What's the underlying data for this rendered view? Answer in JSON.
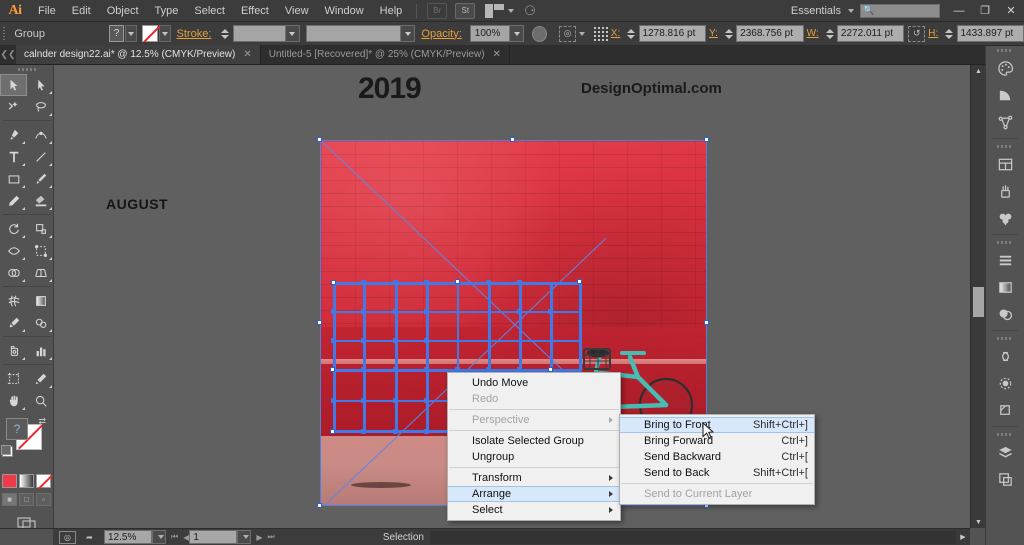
{
  "app": {
    "name": "Adobe Illustrator",
    "logo": "Ai"
  },
  "menubar": {
    "items": [
      "File",
      "Edit",
      "Object",
      "Type",
      "Select",
      "Effect",
      "View",
      "Window",
      "Help"
    ],
    "bridge_label": "Br",
    "stock_label": "St",
    "workspace": "Essentials",
    "search_placeholder": "",
    "window_buttons": {
      "minimize": "—",
      "restore": "❐",
      "close": "✕"
    }
  },
  "controlbar": {
    "selection_type": "Group",
    "fill_label": "?",
    "stroke_label": "Stroke:",
    "stroke_weight": "",
    "stroke_profile": "",
    "opacity_label": "Opacity:",
    "opacity_value": "100%",
    "x_label": "X:",
    "x_value": "1278.816 pt",
    "y_label": "Y:",
    "y_value": "2368.756 pt",
    "w_label": "W:",
    "w_value": "2272.011 pt",
    "h_label": "H:",
    "h_value": "1433.897 pt"
  },
  "tabs": [
    {
      "title": "calnder design22.ai* @ 12.5% (CMYK/Preview)",
      "active": true,
      "close": "✕"
    },
    {
      "title": "Untitled-5 [Recovered]* @ 25% (CMYK/Preview)",
      "active": false,
      "close": "✕"
    }
  ],
  "toolbar": {
    "tools": [
      {
        "name": "selection-tool",
        "selected": true
      },
      {
        "name": "direct-selection-tool",
        "selected": false
      },
      {
        "name": "magic-wand-tool",
        "selected": false
      },
      {
        "name": "lasso-tool",
        "selected": false
      },
      {
        "name": "pen-tool",
        "selected": false
      },
      {
        "name": "curvature-tool",
        "selected": false
      },
      {
        "name": "type-tool",
        "selected": false
      },
      {
        "name": "line-segment-tool",
        "selected": false
      },
      {
        "name": "rectangle-tool",
        "selected": false
      },
      {
        "name": "paintbrush-tool",
        "selected": false
      },
      {
        "name": "pencil-tool",
        "selected": false
      },
      {
        "name": "eraser-tool",
        "selected": false
      },
      {
        "name": "rotate-tool",
        "selected": false
      },
      {
        "name": "scale-tool",
        "selected": false
      },
      {
        "name": "width-tool",
        "selected": false
      },
      {
        "name": "free-transform-tool",
        "selected": false
      },
      {
        "name": "shape-builder-tool",
        "selected": false
      },
      {
        "name": "perspective-grid-tool",
        "selected": false
      },
      {
        "name": "mesh-tool",
        "selected": false
      },
      {
        "name": "gradient-tool",
        "selected": false
      },
      {
        "name": "eyedropper-tool",
        "selected": false
      },
      {
        "name": "blend-tool",
        "selected": false
      },
      {
        "name": "symbol-sprayer-tool",
        "selected": false
      },
      {
        "name": "column-graph-tool",
        "selected": false
      },
      {
        "name": "artboard-tool",
        "selected": false
      },
      {
        "name": "slice-tool",
        "selected": false
      },
      {
        "name": "hand-tool",
        "selected": false
      },
      {
        "name": "zoom-tool",
        "selected": false
      }
    ],
    "fill_stroke": {
      "fill": "none",
      "stroke": "?"
    },
    "color_modes": [
      "color",
      "gradient",
      "none"
    ],
    "screen_modes": [
      "normal-screen-mode",
      "full-screen-with-menu",
      "full-screen"
    ]
  },
  "canvas": {
    "artwork": {
      "year": "2019",
      "watermark": "DesignOptimal.com",
      "month": "AUGUST"
    },
    "selection": {
      "type": "group",
      "mesh_visible": true
    }
  },
  "context_menu": {
    "items": [
      {
        "label": "Undo Move",
        "enabled": true,
        "submenu": false,
        "accel": ""
      },
      {
        "label": "Redo",
        "enabled": false,
        "submenu": false,
        "accel": ""
      },
      {
        "separator": true
      },
      {
        "label": "Perspective",
        "enabled": false,
        "submenu": true,
        "accel": ""
      },
      {
        "separator": true
      },
      {
        "label": "Isolate Selected Group",
        "enabled": true,
        "submenu": false,
        "accel": ""
      },
      {
        "label": "Ungroup",
        "enabled": true,
        "submenu": false,
        "accel": ""
      },
      {
        "separator": true
      },
      {
        "label": "Transform",
        "enabled": true,
        "submenu": true,
        "accel": ""
      },
      {
        "label": "Arrange",
        "enabled": true,
        "submenu": true,
        "accel": "",
        "highlighted": true
      },
      {
        "label": "Select",
        "enabled": true,
        "submenu": true,
        "accel": ""
      }
    ]
  },
  "arrange_submenu": {
    "items": [
      {
        "label": "Bring to Front",
        "accel": "Shift+Ctrl+]",
        "enabled": true,
        "highlighted": true
      },
      {
        "label": "Bring Forward",
        "accel": "Ctrl+]",
        "enabled": true,
        "highlighted": false
      },
      {
        "label": "Send Backward",
        "accel": "Ctrl+[",
        "enabled": true,
        "highlighted": false
      },
      {
        "label": "Send to Back",
        "accel": "Shift+Ctrl+[",
        "enabled": true,
        "highlighted": false
      },
      {
        "separator": true
      },
      {
        "label": "Send to Current Layer",
        "accel": "",
        "enabled": false,
        "highlighted": false
      }
    ]
  },
  "statusbar": {
    "zoom": "12.5%",
    "artboard": "1",
    "status_text": "Selection"
  },
  "dock": {
    "groups": [
      {
        "items": [
          "color-panel-icon",
          "color-guide-panel-icon",
          "symbols-panel-icon"
        ]
      },
      {
        "items": [
          "artboards-panel-icon",
          "brushes-panel-icon",
          "symbols-library-icon"
        ]
      },
      {
        "items": [
          "align-panel-icon",
          "gradient-panel-icon",
          "transparency-panel-icon"
        ]
      },
      {
        "items": [
          "cc-libraries-panel-icon",
          "appearance-panel-icon",
          "graphic-styles-panel-icon"
        ]
      },
      {
        "items": [
          "layers-panel-icon",
          "artboard-nav-icon"
        ]
      }
    ]
  },
  "colors": {
    "chrome": "#3c3c3c",
    "panel": "#535353",
    "canvas": "#606060",
    "accent_orange": "#e2a23c",
    "selection_blue": "#3f7ae8",
    "menu_highlight": "#d8e8fb",
    "wall_red": "#d8303e",
    "bike_teal": "#3fb8b0"
  }
}
